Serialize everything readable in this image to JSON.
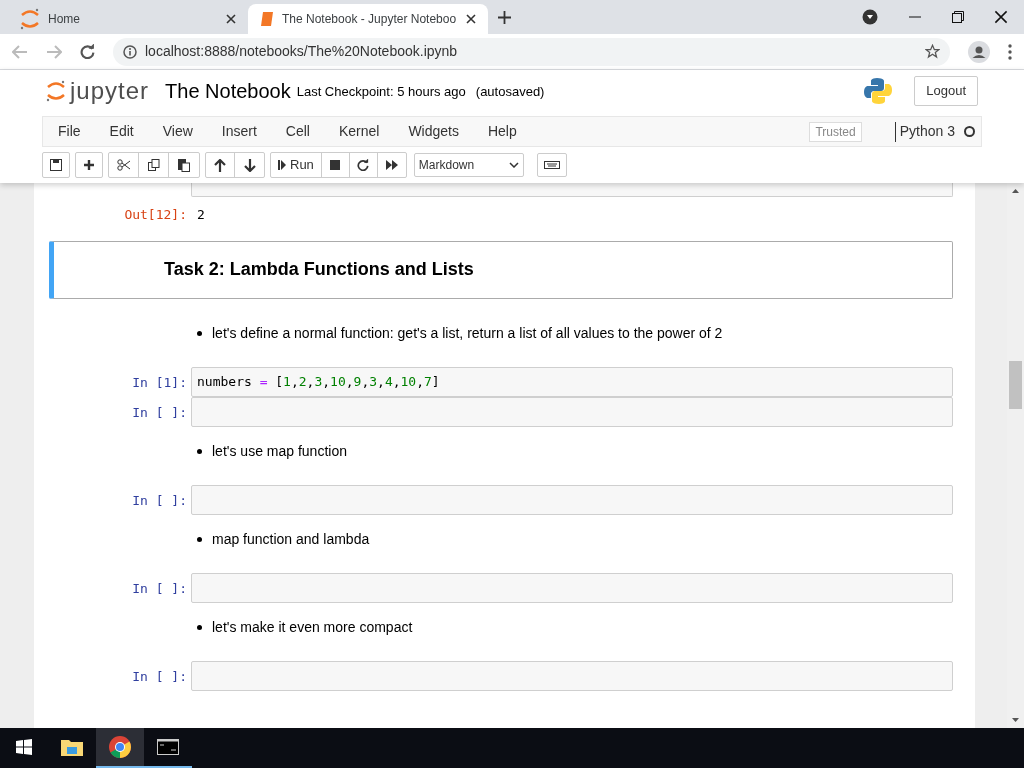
{
  "browser": {
    "tabs": [
      {
        "title": "Home",
        "selected": false
      },
      {
        "title": "The Notebook - Jupyter Noteboo",
        "selected": true
      }
    ],
    "url": "localhost:8888/notebooks/The%20Notebook.ipynb"
  },
  "header": {
    "logo_text": "jupyter",
    "notebook_name": "The Notebook",
    "checkpoint": "Last Checkpoint: 5 hours ago",
    "autosave": "(autosaved)",
    "logout": "Logout"
  },
  "menu": [
    "File",
    "Edit",
    "View",
    "Insert",
    "Cell",
    "Kernel",
    "Widgets",
    "Help"
  ],
  "trusted": "Trusted",
  "kernel": "Python 3",
  "toolbar": {
    "run": "Run",
    "cell_type": "Markdown"
  },
  "cells": [
    {
      "kind": "output",
      "out_prompt": "Out[12]:",
      "output": "2"
    },
    {
      "kind": "heading",
      "text": "Task 2: Lambda Functions and Lists",
      "selected": true
    },
    {
      "kind": "bullet",
      "text": "let's define a normal function: get's a list, return a list of all values to the power of 2"
    },
    {
      "kind": "code",
      "prompt": "In [1]:",
      "tokens": [
        {
          "text": "numbers ",
          "kind": "name"
        },
        {
          "text": "=",
          "kind": "op"
        },
        {
          "text": " [",
          "kind": "bracket"
        },
        {
          "text": "1",
          "kind": "num"
        },
        {
          "text": ",",
          "kind": "name"
        },
        {
          "text": "2",
          "kind": "num"
        },
        {
          "text": ",",
          "kind": "name"
        },
        {
          "text": "3",
          "kind": "num"
        },
        {
          "text": ",",
          "kind": "name"
        },
        {
          "text": "10",
          "kind": "num"
        },
        {
          "text": ",",
          "kind": "name"
        },
        {
          "text": "9",
          "kind": "num"
        },
        {
          "text": ",",
          "kind": "name"
        },
        {
          "text": "3",
          "kind": "num"
        },
        {
          "text": ",",
          "kind": "name"
        },
        {
          "text": "4",
          "kind": "num"
        },
        {
          "text": ",",
          "kind": "name"
        },
        {
          "text": "10",
          "kind": "num"
        },
        {
          "text": ",",
          "kind": "name"
        },
        {
          "text": "7",
          "kind": "num"
        },
        {
          "text": "]",
          "kind": "bracket"
        }
      ]
    },
    {
      "kind": "code",
      "prompt": "In [ ]:"
    },
    {
      "kind": "bullet",
      "text": "let's use map function"
    },
    {
      "kind": "code",
      "prompt": "In [ ]:"
    },
    {
      "kind": "bullet",
      "text": "map function and lambda"
    },
    {
      "kind": "code",
      "prompt": "In [ ]:"
    },
    {
      "kind": "bullet",
      "text": "let's make it even more compact"
    },
    {
      "kind": "code",
      "prompt": "In [ ]:"
    }
  ],
  "taskbar": [
    {
      "selected": false
    },
    {
      "selected": false
    },
    {
      "selected": true
    },
    {
      "selected": false
    }
  ]
}
